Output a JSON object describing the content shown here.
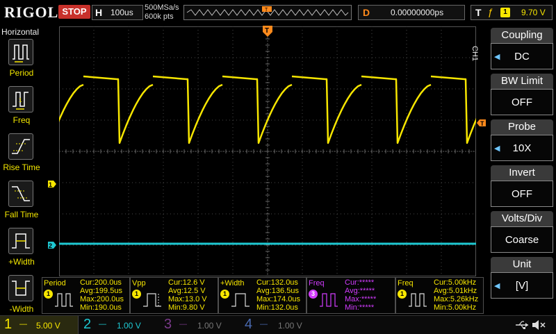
{
  "top": {
    "logo": "RIGOL",
    "status": "STOP",
    "horizontal_key": "H",
    "timebase": "100us",
    "sample_rate": "500MSa/s",
    "memory_depth": "600k pts",
    "trigger_marker": "T",
    "delay_key": "D",
    "delay_value": "0.00000000ps",
    "trigger_key": "T",
    "trigger_edge": "ƒ",
    "trigger_source": "1",
    "trigger_level": "9.70 V"
  },
  "left_menu": {
    "title": "Horizontal",
    "items": [
      {
        "label": "Period"
      },
      {
        "label": "Freq"
      },
      {
        "label": "Rise Time"
      },
      {
        "label": "Fall Time"
      },
      {
        "label": "+Width"
      },
      {
        "label": "-Width"
      }
    ]
  },
  "right_menu": {
    "channel_label": "CH1",
    "items": [
      {
        "title": "Coupling",
        "value": "DC",
        "has_arrow": true
      },
      {
        "title": "BW Limit",
        "value": "OFF",
        "has_arrow": false
      },
      {
        "title": "Probe",
        "value": "10X",
        "has_arrow": true
      },
      {
        "title": "Invert",
        "value": "OFF",
        "has_arrow": false
      },
      {
        "title": "Volts/Div",
        "value": "Coarse",
        "has_arrow": false
      },
      {
        "title": "Unit",
        "value": "[V]",
        "has_arrow": true
      }
    ]
  },
  "markers": {
    "ch1": "1",
    "ch2": "2",
    "trigger_level": "T"
  },
  "measurements": [
    {
      "name": "Period",
      "badge": "1",
      "color": "#f7e600",
      "cur": "Cur:200.0us",
      "avg": "Avg:199.5us",
      "max": "Max:200.0us",
      "min": "Min:190.0us"
    },
    {
      "name": "Vpp",
      "badge": "1",
      "color": "#f7e600",
      "cur": "Cur:12.6 V",
      "avg": "Avg:12.5 V",
      "max": "Max:13.0 V",
      "min": "Min:9.80 V"
    },
    {
      "name": "+Width",
      "badge": "1",
      "color": "#f7e600",
      "cur": "Cur:132.0us",
      "avg": "Avg:136.5us",
      "max": "Max:174.0us",
      "min": "Min:132.0us"
    },
    {
      "name": "Freq",
      "badge": "3",
      "color": "#d23cff",
      "cur": "Cur:*****",
      "avg": "Avg:*****",
      "max": "Max:*****",
      "min": "Min:*****"
    },
    {
      "name": "Freq",
      "badge": "1",
      "color": "#f7e600",
      "cur": "Cur:5.00kHz",
      "avg": "Avg:5.01kHz",
      "max": "Max:5.26kHz",
      "min": "Min:5.00kHz"
    }
  ],
  "channels": [
    {
      "num": "1",
      "scale": "5.00 V",
      "color": "#f7e600",
      "active": true
    },
    {
      "num": "2",
      "scale": "1.00 V",
      "color": "#1ec8d2",
      "active": false
    },
    {
      "num": "3",
      "scale": "1.00 V",
      "color": "#7a3a8a",
      "active": false
    },
    {
      "num": "4",
      "scale": "1.00 V",
      "color": "#4a6ab0",
      "active": false
    }
  ],
  "colors": {
    "ch1": "#f7e600",
    "ch2": "#1ec8d2",
    "trigger": "#ff8a1c",
    "stop": "#c8312b"
  }
}
